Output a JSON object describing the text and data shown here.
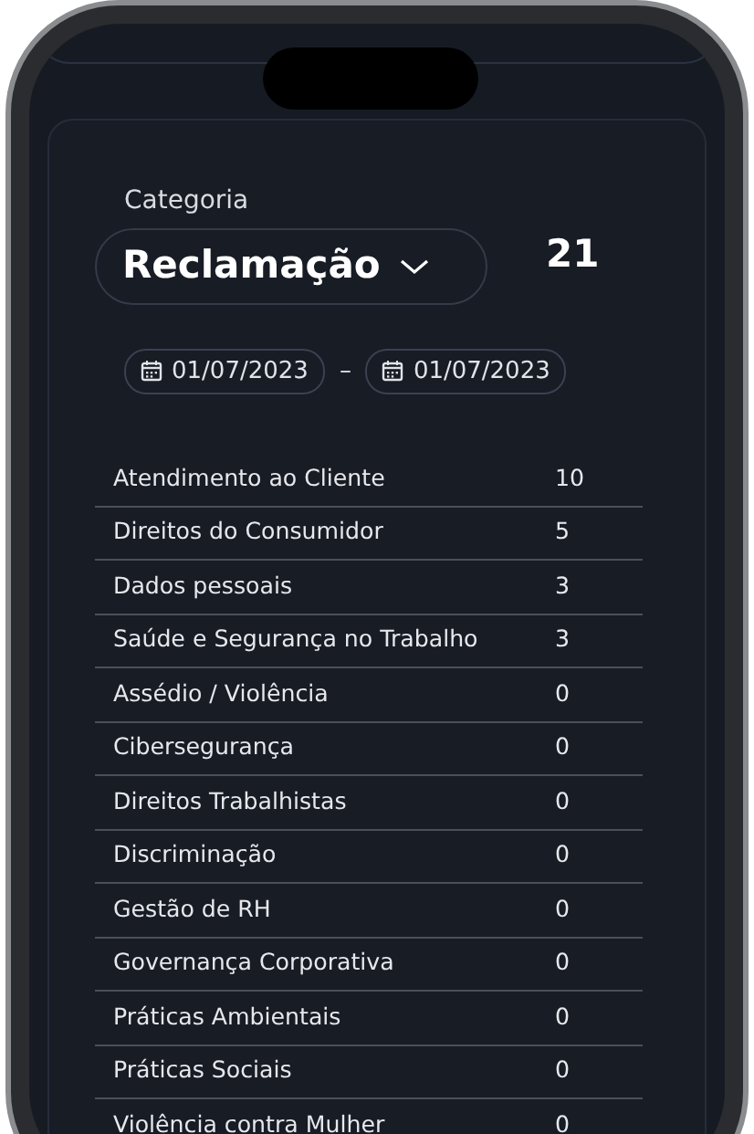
{
  "category": {
    "label": "Categoria",
    "value": "Reclamação"
  },
  "total": "21",
  "date_range": {
    "start": "01/07/2023",
    "separator": "–",
    "end": "01/07/2023"
  },
  "rows": [
    {
      "name": "Atendimento ao Cliente",
      "count": "10"
    },
    {
      "name": "Direitos do Consumidor",
      "count": "5"
    },
    {
      "name": "Dados pessoais",
      "count": "3"
    },
    {
      "name": "Saúde e Segurança no Trabalho",
      "count": "3"
    },
    {
      "name": "Assédio / Violência",
      "count": "0"
    },
    {
      "name": "Cibersegurança",
      "count": "0"
    },
    {
      "name": "Direitos Trabalhistas",
      "count": "0"
    },
    {
      "name": "Discriminação",
      "count": "0"
    },
    {
      "name": "Gestão de RH",
      "count": "0"
    },
    {
      "name": "Governança Corporativa",
      "count": "0"
    },
    {
      "name": "Práticas Ambientais",
      "count": "0"
    },
    {
      "name": "Práticas Sociais",
      "count": "0"
    },
    {
      "name": "Violência contra Mulher",
      "count": "0"
    }
  ]
}
